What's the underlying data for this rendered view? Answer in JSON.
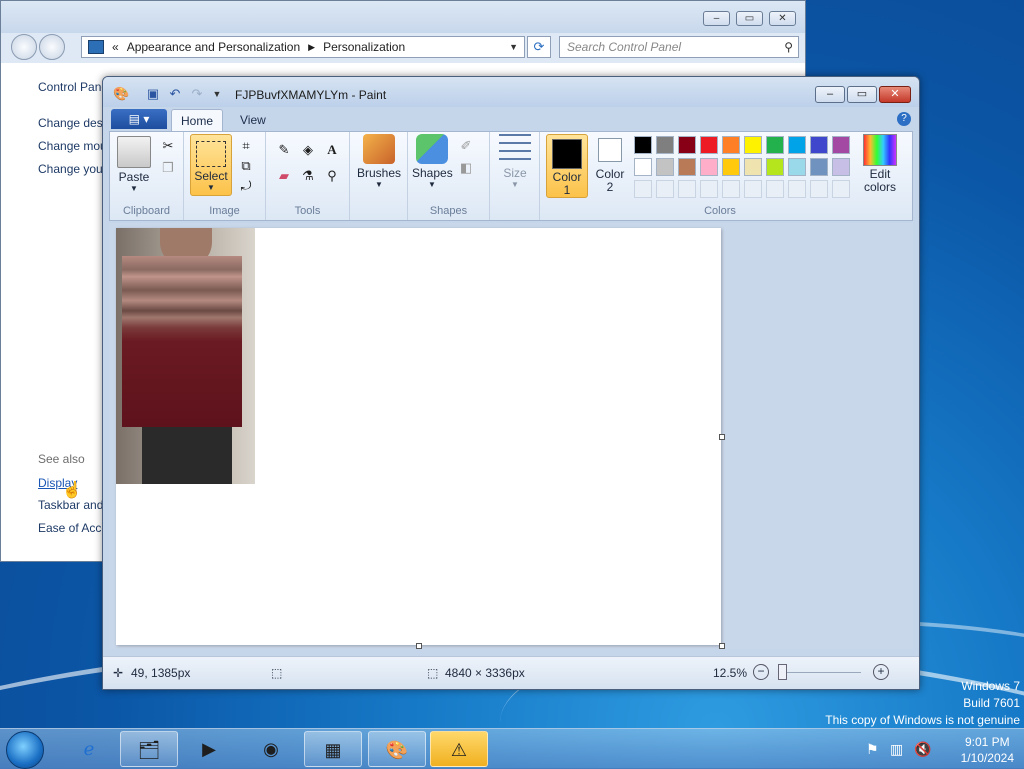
{
  "control_panel": {
    "breadcrumb_1": "Appearance and Personalization",
    "breadcrumb_2": "Personalization",
    "search_placeholder": "Search Control Panel",
    "sidebar_home": "Control Panel Home",
    "sidebar_items": [
      "Change desktop icons",
      "Change mouse pointers",
      "Change your account picture"
    ],
    "see_also": "See also",
    "see_also_links": [
      "Display",
      "Taskbar and Start Menu",
      "Ease of Access Center"
    ]
  },
  "paint": {
    "title": "FJPBuvfXMAMYLYm - Paint",
    "tabs": {
      "home": "Home",
      "view": "View"
    },
    "ribbon": {
      "clipboard": {
        "paste": "Paste",
        "label": "Clipboard"
      },
      "image": {
        "select": "Select",
        "label": "Image"
      },
      "tools": {
        "label": "Tools"
      },
      "brushes": "Brushes",
      "shapes": {
        "shapes": "Shapes",
        "label": "Shapes"
      },
      "size": "Size",
      "color1": "Color\n1",
      "color2": "Color\n2",
      "colors_label": "Colors",
      "edit_colors": "Edit colors"
    },
    "palette_row1": [
      "#000000",
      "#7f7f7f",
      "#880015",
      "#ed1c24",
      "#ff7f27",
      "#fff200",
      "#22b14c",
      "#00a2e8",
      "#3f48cc",
      "#a349a4"
    ],
    "palette_row2": [
      "#ffffff",
      "#c3c3c3",
      "#b97a57",
      "#ffaec9",
      "#ffc90e",
      "#efe4b0",
      "#b5e61d",
      "#99d9ea",
      "#7092be",
      "#c8bfe7"
    ],
    "status": {
      "cursor_pos": "49, 1385px",
      "image_size": "4840 × 3336px",
      "zoom": "12.5%"
    }
  },
  "desktop": {
    "watermark_line1": "Windows 7",
    "watermark_line2": "Build 7601",
    "watermark_line3": "This copy of Windows is not genuine"
  },
  "taskbar": {
    "time": "9:01 PM",
    "date": "1/10/2024"
  }
}
